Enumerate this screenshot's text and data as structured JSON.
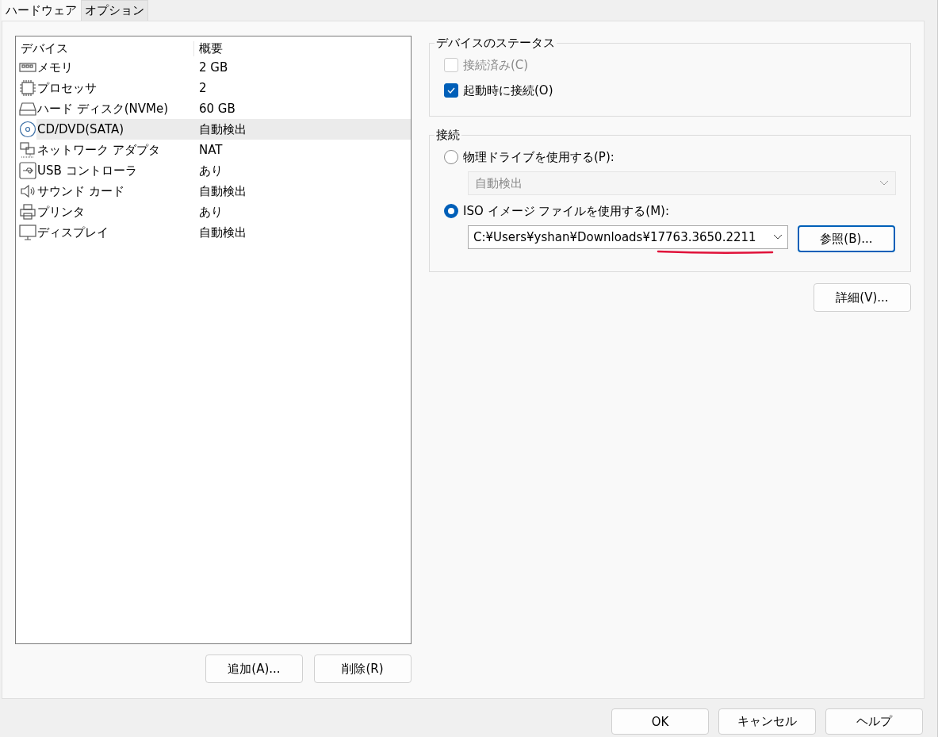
{
  "tabs": [
    {
      "label": "ハードウェア",
      "selected": true
    },
    {
      "label": "オプション",
      "selected": false
    }
  ],
  "device_list": {
    "columns": [
      "デバイス",
      "概要"
    ],
    "rows": [
      {
        "kind": "memory",
        "name": "メモリ",
        "summary": "2 GB",
        "selected": false
      },
      {
        "kind": "cpu",
        "name": "プロセッサ",
        "summary": "2",
        "selected": false
      },
      {
        "kind": "disk",
        "name": "ハード ディスク(NVMe)",
        "summary": "60 GB",
        "selected": false
      },
      {
        "kind": "cd",
        "name": "CD/DVD(SATA)",
        "summary": "自動検出",
        "selected": true
      },
      {
        "kind": "network",
        "name": "ネットワーク アダプタ",
        "summary": "NAT",
        "selected": false
      },
      {
        "kind": "usb",
        "name": "USB コントローラ",
        "summary": "あり",
        "selected": false
      },
      {
        "kind": "sound",
        "name": "サウンド カード",
        "summary": "自動検出",
        "selected": false
      },
      {
        "kind": "printer",
        "name": "プリンタ",
        "summary": "あり",
        "selected": false
      },
      {
        "kind": "display",
        "name": "ディスプレイ",
        "summary": "自動検出",
        "selected": false
      }
    ]
  },
  "list_buttons": [
    "追加(A)...",
    "削除(R)"
  ],
  "device_status": {
    "title": "デバイスのステータス",
    "options": [
      {
        "label": "接続済み(C)",
        "checked": false,
        "disabled": true
      },
      {
        "label": "起動時に接続(O)",
        "checked": true,
        "disabled": false
      }
    ]
  },
  "connection": {
    "title": "接続",
    "physical": {
      "label": "物理ドライブを使用する(P):",
      "selected": false,
      "drive": "自動検出",
      "disabled": true
    },
    "iso": {
      "label": "ISO イメージ ファイルを使用する(M):",
      "selected": true,
      "path": "C:¥Users¥yshan¥Downloads¥17763.3650.2211",
      "annotated": true,
      "browse": "参照(B)..."
    }
  },
  "advanced_button": "詳細(V)...",
  "dialog_buttons": [
    "OK",
    "キャンセル",
    "ヘルプ"
  ]
}
